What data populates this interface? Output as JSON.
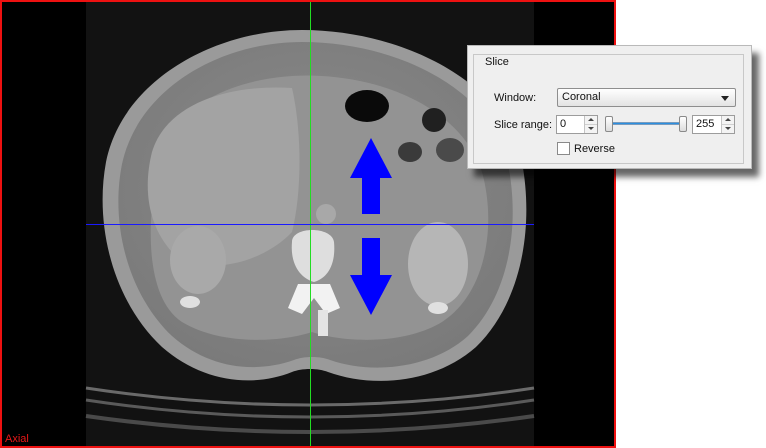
{
  "viewport": {
    "label": "Axial",
    "border_color": "#ee1111",
    "crosshair_vertical_color": "#22dd22",
    "crosshair_horizontal_color": "#1a1aff",
    "arrow_color": "#0000ff",
    "arrow_icons": [
      "arrow-up-icon",
      "arrow-down-icon"
    ]
  },
  "slice_panel": {
    "title": "Slice",
    "window_label": "Window:",
    "window_value": "Coronal",
    "range_label": "Slice range:",
    "range_min": "0",
    "range_max": "255",
    "reverse_label": "Reverse",
    "reverse_checked": false,
    "slider_accent": "#2a8fe0"
  }
}
